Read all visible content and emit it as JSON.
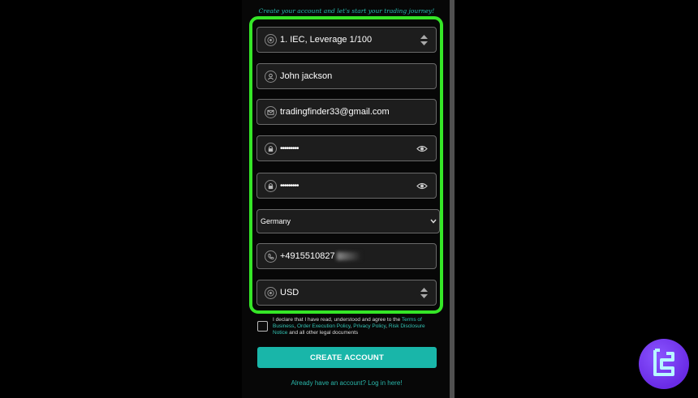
{
  "subtitle": "Create your account and let's start your trading journey!",
  "fields": {
    "account_type": "1. IEC, Leverage 1/100",
    "name": "John jackson",
    "email": "tradingfinder33@gmail.com",
    "password": "•••••••••",
    "confirm_password": "•••••••••",
    "country": "Germany",
    "phone": "+4915510827",
    "currency": "USD"
  },
  "terms": {
    "prefix": "I declare that I have read, understood and agree to the",
    "link1": "Terms of Business",
    "sep1": ",",
    "link2": "Order Execution Policy",
    "sep2": ",",
    "link3": "Privacy Policy",
    "sep3": ",",
    "link4": "Risk Disclosure Notice",
    "suffix": "and all other legal documents"
  },
  "create_button": "CREATE ACCOUNT",
  "login_link": "Already have an account? Log in here!",
  "colors": {
    "highlight": "#35e627",
    "accent": "#19b6a9",
    "logo": "#7a3df0"
  }
}
